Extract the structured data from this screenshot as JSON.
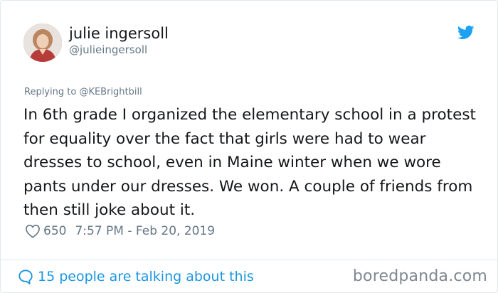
{
  "tweet": {
    "author": {
      "display_name": "julie ingersoll",
      "handle": "@julieingersoll"
    },
    "reply": {
      "prefix": "Replying to ",
      "mention": "@KEBrightbill"
    },
    "text": "In 6th grade I organized the elementary school in a protest for equality over the fact that girls were had to wear dresses to school, even in Maine winter when we wore pants under our dresses. We won. A couple of friends from then still joke about it.",
    "likes": "650",
    "timestamp": "7:57 PM - Feb 20, 2019",
    "talking": "15 people are talking about this"
  },
  "watermark": "boredpanda.com",
  "icons": {
    "brand": "twitter-bird-icon",
    "like": "heart-icon",
    "conversation": "speech-bubble-icon"
  },
  "colors": {
    "link": "#1b95e0",
    "text": "#14171a",
    "secondary": "#657786",
    "twitter_blue": "#1da1f2"
  }
}
